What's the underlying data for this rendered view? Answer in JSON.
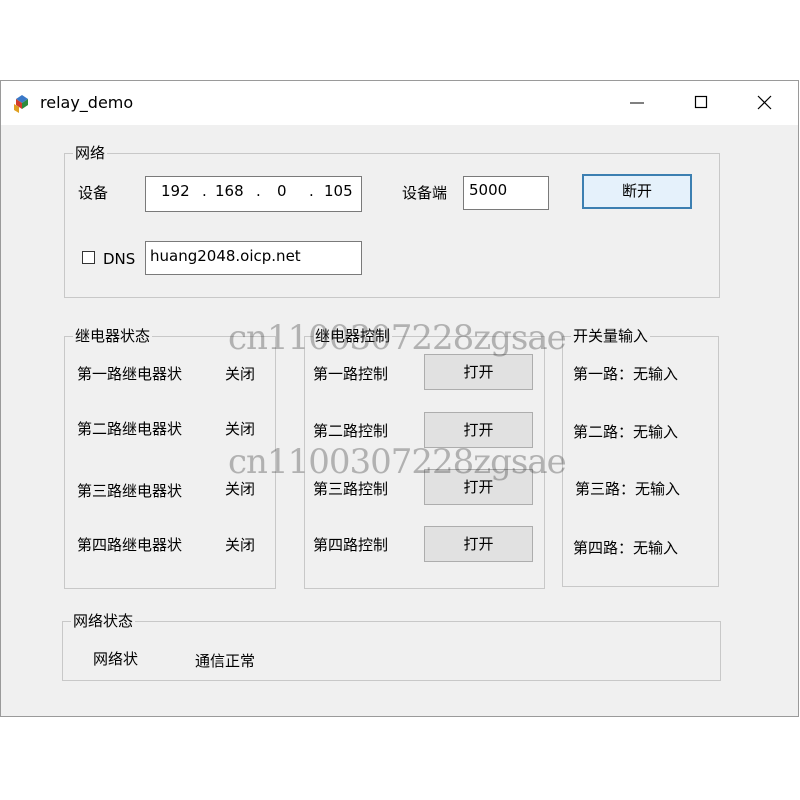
{
  "window": {
    "title": "relay_demo"
  },
  "network": {
    "group_title": "网络",
    "device_label": "设备",
    "ip": [
      "192",
      "168",
      "0",
      "105"
    ],
    "ip_dot": ".",
    "port_label": "设备端",
    "port_value": "5000",
    "disconnect_label": "断开",
    "dns_label": "DNS",
    "dns_checked": false,
    "dns_value": "huang2048.oicp.net"
  },
  "relay_status": {
    "group_title": "继电器状态",
    "rows": [
      {
        "label": "第一路继电器状",
        "value": "关闭"
      },
      {
        "label": "第二路继电器状",
        "value": "关闭"
      },
      {
        "label": "第三路继电器状",
        "value": "关闭"
      },
      {
        "label": "第四路继电器状",
        "value": "关闭"
      }
    ]
  },
  "relay_control": {
    "group_title": "继电器控制",
    "rows": [
      {
        "label": "第一路控制",
        "button": "打开"
      },
      {
        "label": "第二路控制",
        "button": "打开"
      },
      {
        "label": "第三路控制",
        "button": "打开"
      },
      {
        "label": "第四路控制",
        "button": "打开"
      }
    ]
  },
  "switch_input": {
    "group_title": "开关量输入",
    "rows": [
      "第一路：无输入",
      "第二路：无输入",
      "第三路：无输入",
      "第四路：无输入"
    ]
  },
  "network_status": {
    "group_title": "网络状态",
    "label": "网络状",
    "value": "通信正常"
  },
  "watermark": "cn1100307228zgsae"
}
